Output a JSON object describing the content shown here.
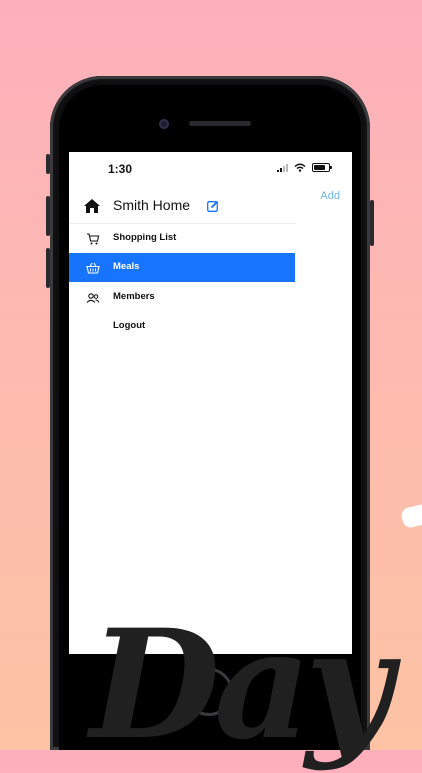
{
  "status_bar": {
    "time": "1:30"
  },
  "header": {
    "add_label": "Add",
    "home_name": "Smith Home"
  },
  "menu": {
    "items": [
      {
        "label": "Shopping List",
        "icon": "cart-icon",
        "active": false
      },
      {
        "label": "Meals",
        "icon": "basket-icon",
        "active": true
      },
      {
        "label": "Members",
        "icon": "people-icon",
        "active": false
      },
      {
        "label": "Logout",
        "icon": "",
        "active": false
      }
    ]
  },
  "colors": {
    "accent": "#1774fe",
    "add_link": "#6fb3e8",
    "background_top": "#fdb0bc",
    "background_bottom": "#fdc3a4"
  },
  "decoration": {
    "brush_text": "Day"
  }
}
